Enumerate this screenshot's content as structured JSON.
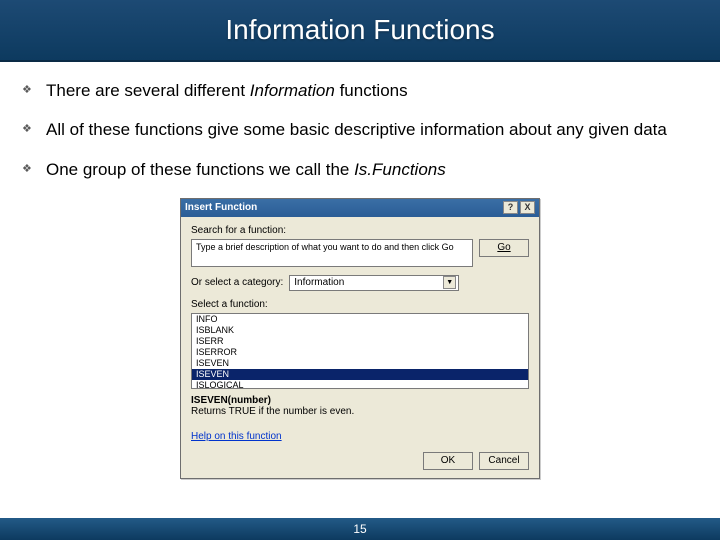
{
  "title": "Information Functions",
  "bullets": [
    {
      "pre": "There are several different ",
      "em": "Information",
      "post": " functions"
    },
    {
      "pre": "All of these functions give some basic descriptive information about any given data",
      "em": "",
      "post": ""
    },
    {
      "pre": "One group of these functions we call the ",
      "em": "Is.Functions",
      "post": ""
    }
  ],
  "dialog": {
    "title": "Insert Function",
    "help_btn": "?",
    "close_btn": "X",
    "search_label": "Search for a function:",
    "search_text": "Type a brief description of what you want to do and then click Go",
    "go_label": "Go",
    "category_label": "Or select a category:",
    "category_value": "Information",
    "select_label": "Select a function:",
    "functions": [
      "INFO",
      "ISBLANK",
      "ISERR",
      "ISERROR",
      "ISEVEN",
      "ISEVEN",
      "ISLOGICAL"
    ],
    "selected_index": 5,
    "signature": "ISEVEN(number)",
    "description": "Returns TRUE if the number is even.",
    "help_link": "Help on this function",
    "ok_label": "OK",
    "cancel_label": "Cancel"
  },
  "page_number": "15"
}
